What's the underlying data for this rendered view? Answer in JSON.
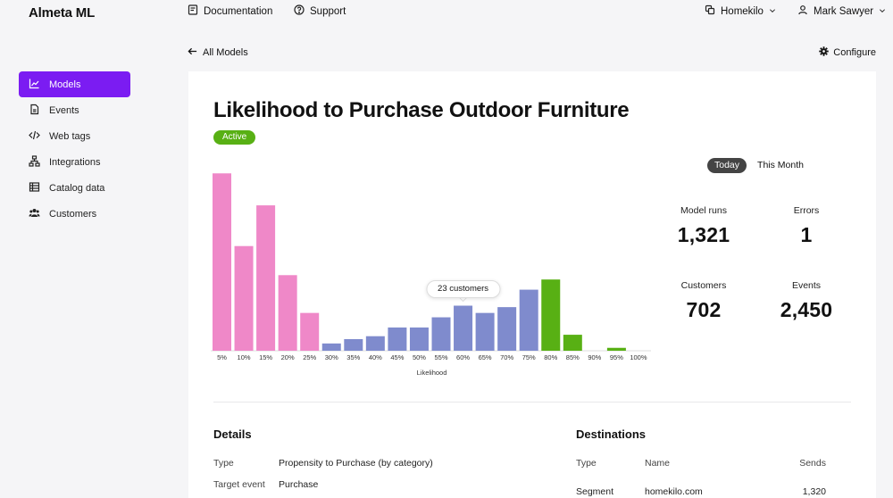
{
  "app": {
    "name": "Almeta ML"
  },
  "topnav": {
    "documentation": "Documentation",
    "support": "Support",
    "workspace": "Homekilo",
    "user": "Mark Sawyer"
  },
  "sidebar": {
    "items": [
      {
        "label": "Models",
        "icon": "chart-icon",
        "active": true
      },
      {
        "label": "Events",
        "icon": "document-icon"
      },
      {
        "label": "Web tags",
        "icon": "code-icon"
      },
      {
        "label": "Integrations",
        "icon": "network-icon"
      },
      {
        "label": "Catalog data",
        "icon": "table-icon"
      },
      {
        "label": "Customers",
        "icon": "users-icon"
      }
    ]
  },
  "nav": {
    "back": "All Models",
    "configure": "Configure"
  },
  "model": {
    "title": "Likelihood to Purchase Outdoor Furniture",
    "status": "Active"
  },
  "range": {
    "today": "Today",
    "month": "This Month",
    "selected": "Today"
  },
  "stats": {
    "runs_label": "Model runs",
    "runs": "1,321",
    "errors_label": "Errors",
    "errors": "1",
    "customers_label": "Customers",
    "customers": "702",
    "events_label": "Events",
    "events": "2,450"
  },
  "tooltip": "23 customers",
  "colors": {
    "accent": "#7b1cf2",
    "pink": "#ef88c8",
    "blue": "#7f8bcd",
    "green": "#58b014"
  },
  "chart_data": {
    "type": "bar",
    "xlabel": "Likelihood",
    "categories": [
      "5%",
      "10%",
      "15%",
      "20%",
      "25%",
      "30%",
      "35%",
      "40%",
      "45%",
      "50%",
      "55%",
      "60%",
      "65%",
      "70%",
      "75%",
      "80%",
      "85%",
      "90%",
      "95%",
      "100%"
    ],
    "values": [
      61,
      36,
      50,
      26,
      13,
      2.5,
      4,
      5,
      8,
      8,
      11.5,
      15.5,
      13,
      15,
      21,
      24.5,
      5.5,
      0,
      1,
      0
    ],
    "groups": [
      "pink",
      "pink",
      "pink",
      "pink",
      "pink",
      "blue",
      "blue",
      "blue",
      "blue",
      "blue",
      "blue",
      "blue",
      "blue",
      "blue",
      "blue",
      "green",
      "green",
      "green",
      "green",
      "green"
    ],
    "ylim": [
      0,
      62
    ],
    "highlight_index": 11
  },
  "details": {
    "title": "Details",
    "rows": [
      {
        "key": "Type",
        "value": "Propensity to Purchase (by category)"
      },
      {
        "key": "Target event",
        "value": "Purchase"
      }
    ]
  },
  "destinations": {
    "title": "Destinations",
    "headers": [
      "Type",
      "Name",
      "Sends"
    ],
    "rows": [
      {
        "type": "Segment",
        "name": "homekilo.com",
        "sends": "1,320"
      }
    ]
  }
}
